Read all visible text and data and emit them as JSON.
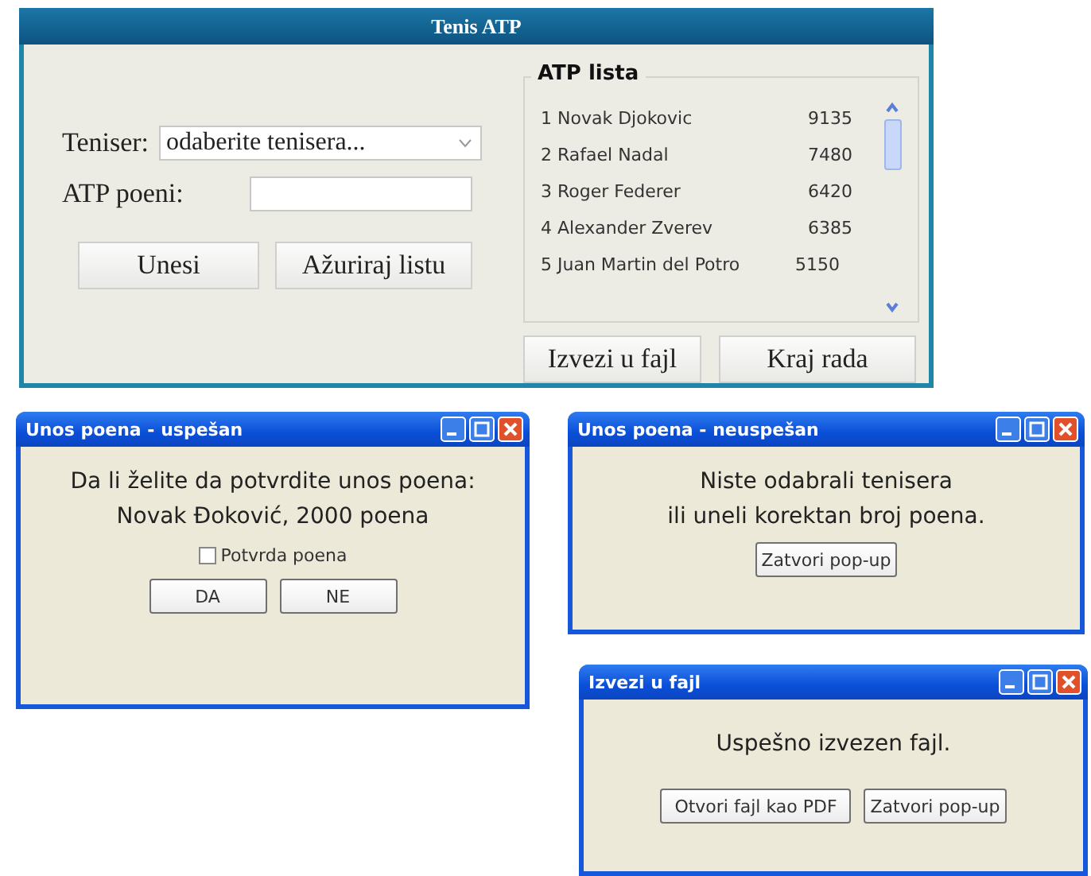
{
  "main_window": {
    "title": "Tenis ATP",
    "player_label": "Teniser:",
    "player_select": {
      "value": "odaberite tenisera..."
    },
    "points_label": "ATP poeni:",
    "buttons": [
      "Unesi",
      "Ažuriraj listu"
    ],
    "ranking": {
      "title": "ATP lista",
      "rows": [
        {
          "player": "1 Novak Djokovic",
          "points": "9135"
        },
        {
          "player": "2 Rafael Nadal",
          "points": "7480"
        },
        {
          "player": "3 Roger Federer",
          "points": "6420"
        },
        {
          "player": "4 Alexander Zverev",
          "points": "6385"
        },
        {
          "player": "5 Juan Martin del Potro",
          "points": "5150"
        }
      ]
    },
    "bottom_buttons": [
      "Izvezi u fajl",
      "Kraj rada"
    ]
  },
  "dialogs": [
    {
      "title": "Unos poena - uspešan",
      "lines": [
        "Da li želite da potvrdite unos poena:",
        "Novak Đoković, 2000 poena"
      ],
      "checkbox": {
        "label": "Potvrda poena",
        "checked": false
      },
      "buttons": [
        "DA",
        "NE"
      ]
    },
    {
      "title": "Unos poena - neuspešan",
      "lines": [
        "Niste odabrali tenisera",
        "ili uneli korektan broj poena."
      ],
      "buttons": [
        "Zatvori pop-up"
      ]
    },
    {
      "title": "Izvezi u fajl",
      "lines": [
        "Uspešno izvezen fajl."
      ],
      "buttons": [
        "Otvori fajl kao PDF",
        "Zatvori pop-up"
      ]
    }
  ]
}
